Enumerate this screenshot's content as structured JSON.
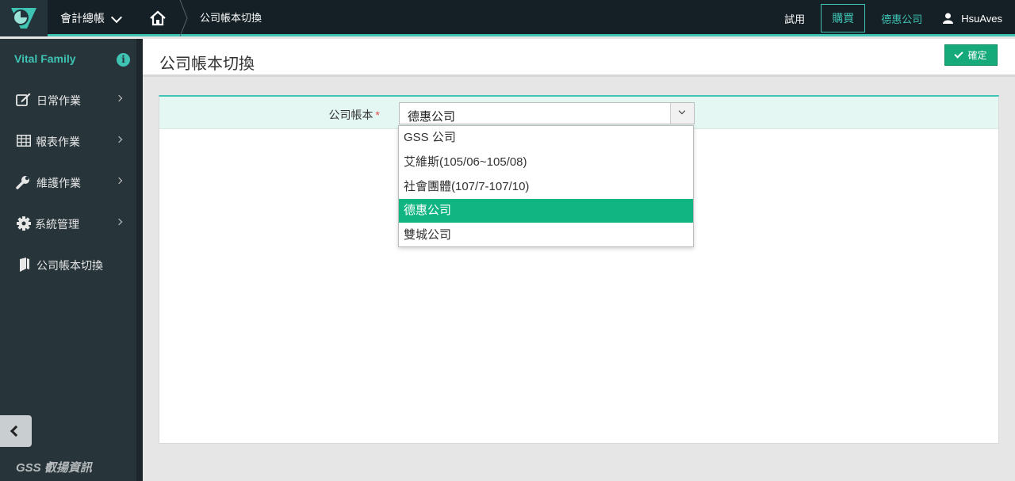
{
  "topbar": {
    "module": "會計總帳",
    "breadcrumb": "公司帳本切換",
    "trial": "試用",
    "buy": "購買",
    "company": "德惠公司",
    "user": "HsuAves"
  },
  "sidebar": {
    "title": "Vital Family",
    "info_glyph": "i",
    "items": [
      {
        "label": "日常作業",
        "icon": "edit-icon"
      },
      {
        "label": "報表作業",
        "icon": "table-icon"
      },
      {
        "label": "維護作業",
        "icon": "wrench-icon"
      },
      {
        "label": "系統管理",
        "icon": "gear-icon"
      },
      {
        "label": "公司帳本切換",
        "icon": "book-icon"
      }
    ],
    "brand": "GSS 叡揚資訊"
  },
  "page": {
    "title": "公司帳本切換",
    "confirm": "確定"
  },
  "form": {
    "label": "公司帳本",
    "required_mark": "*",
    "selected": "德惠公司",
    "options": [
      "GSS 公司",
      "艾維斯(105/06~105/08)",
      "社會團體(107/7-107/10)",
      "德惠公司",
      "雙城公司"
    ],
    "selected_index": 3
  },
  "colors": {
    "accent": "#3fc4b4",
    "selected_option": "#11b582",
    "confirm_button": "#16a97a",
    "topbar": "#152026",
    "sidebar": "#27343a"
  }
}
